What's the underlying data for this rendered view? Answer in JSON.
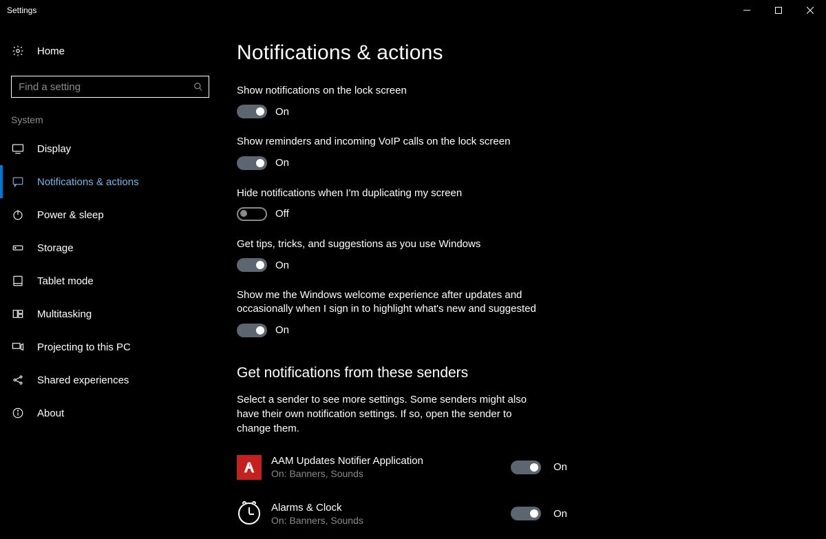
{
  "window": {
    "title": "Settings"
  },
  "sidebar": {
    "home_label": "Home",
    "search_placeholder": "Find a setting",
    "section_label": "System",
    "items": [
      {
        "label": "Display",
        "icon": "display",
        "selected": false
      },
      {
        "label": "Notifications & actions",
        "icon": "notifications",
        "selected": true
      },
      {
        "label": "Power & sleep",
        "icon": "power",
        "selected": false
      },
      {
        "label": "Storage",
        "icon": "storage",
        "selected": false
      },
      {
        "label": "Tablet mode",
        "icon": "tablet",
        "selected": false
      },
      {
        "label": "Multitasking",
        "icon": "multitasking",
        "selected": false
      },
      {
        "label": "Projecting to this PC",
        "icon": "project",
        "selected": false
      },
      {
        "label": "Shared experiences",
        "icon": "shared",
        "selected": false
      },
      {
        "label": "About",
        "icon": "about",
        "selected": false
      }
    ]
  },
  "main": {
    "page_title": "Notifications & actions",
    "toggle_labels": {
      "on": "On",
      "off": "Off"
    },
    "settings": [
      {
        "text": "Show notifications on the lock screen",
        "value": true
      },
      {
        "text": "Show reminders and incoming VoIP calls on the lock screen",
        "value": true
      },
      {
        "text": "Hide notifications when I'm duplicating my screen",
        "value": false
      },
      {
        "text": "Get tips, tricks, and suggestions as you use Windows",
        "value": true
      },
      {
        "text": "Show me the Windows welcome experience after updates and occasionally when I sign in to highlight what's new and suggested",
        "value": true
      }
    ],
    "senders_title": "Get notifications from these senders",
    "senders_desc": "Select a sender to see more settings. Some senders might also have their own notification settings. If so, open the sender to change them.",
    "senders": [
      {
        "name": "AAM Updates Notifier Application",
        "sub": "On: Banners, Sounds",
        "value": true,
        "icon": "adobe"
      },
      {
        "name": "Alarms & Clock",
        "sub": "On: Banners, Sounds",
        "value": true,
        "icon": "clock"
      }
    ]
  }
}
